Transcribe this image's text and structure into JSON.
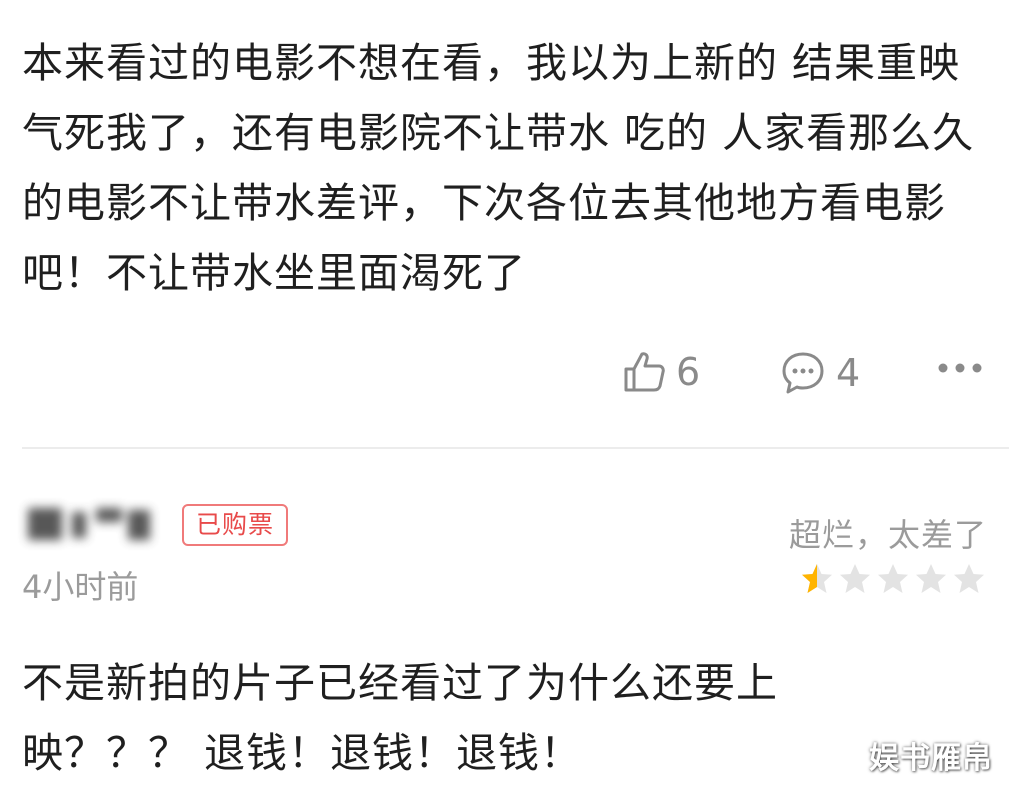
{
  "comment1": {
    "text": "本来看过的电影不想在看，我以为上新的 结果重映气死我了，还有电影院不让带水 吃的 人家看那么久的电影不让带水差评，下次各位去其他地方看电影吧！不让带水坐里面渴死了",
    "like_count": "6",
    "reply_count": "4",
    "icons": {
      "like": "thumbs-up-icon",
      "reply": "comment-bubble-icon",
      "more": "more-dots-icon"
    }
  },
  "comment2": {
    "badge": "已购票",
    "time": "4小时前",
    "rating_text": "超烂，太差了",
    "rating": {
      "stars": 0.5,
      "max": 5
    },
    "text": "不是新拍的片子已经看过了为什么还要上映？？？ 退钱！退钱！退钱！"
  },
  "watermark": "娱书雁帛",
  "colors": {
    "text": "#1f1f1f",
    "muted": "#9b9b9b",
    "badge": "#e84a4a",
    "star_active": "#ffb400",
    "star_inactive": "#e3e3e3",
    "divider": "#ececec"
  }
}
